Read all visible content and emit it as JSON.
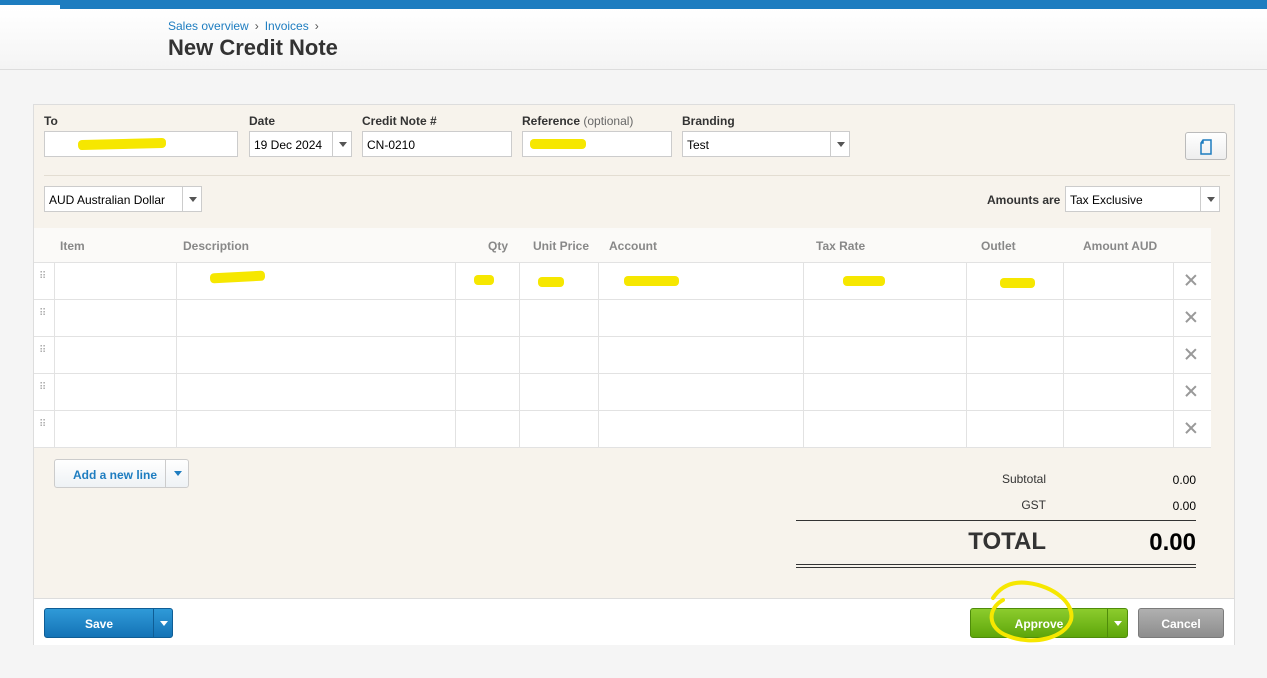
{
  "breadcrumb": {
    "items": [
      "Sales overview",
      "Invoices"
    ],
    "separator": "›"
  },
  "page": {
    "title": "New Credit Note"
  },
  "form": {
    "to_label": "To",
    "to_value": "",
    "date_label": "Date",
    "date_value": "19 Dec 2024",
    "number_label": "Credit Note #",
    "number_value": "CN-0210",
    "reference_label": "Reference",
    "reference_optional": "(optional)",
    "reference_value": "",
    "branding_label": "Branding",
    "branding_value": "Test",
    "currency_value": "AUD Australian Dollar",
    "amounts_label": "Amounts are",
    "amounts_value": "Tax Exclusive"
  },
  "table": {
    "columns": [
      "Item",
      "Description",
      "Qty",
      "Unit Price",
      "Account",
      "Tax Rate",
      "Outlet",
      "Amount AUD"
    ],
    "rows": [
      [
        "",
        "",
        "",
        "",
        "",
        "",
        "",
        ""
      ],
      [
        "",
        "",
        "",
        "",
        "",
        "",
        "",
        ""
      ],
      [
        "",
        "",
        "",
        "",
        "",
        "",
        "",
        ""
      ],
      [
        "",
        "",
        "",
        "",
        "",
        "",
        "",
        ""
      ],
      [
        "",
        "",
        "",
        "",
        "",
        "",
        "",
        ""
      ]
    ]
  },
  "add_line": {
    "label": "Add a new line"
  },
  "totals": {
    "subtotal_label": "Subtotal",
    "subtotal_value": "0.00",
    "gst_label": "GST",
    "gst_value": "0.00",
    "total_label": "TOTAL",
    "total_value": "0.00"
  },
  "actions": {
    "save_label": "Save",
    "approve_label": "Approve",
    "cancel_label": "Cancel"
  },
  "colors": {
    "brand_blue": "#1e7dc0",
    "approve_green": "#6bb31a",
    "redaction_highlight": "#f6e700"
  }
}
